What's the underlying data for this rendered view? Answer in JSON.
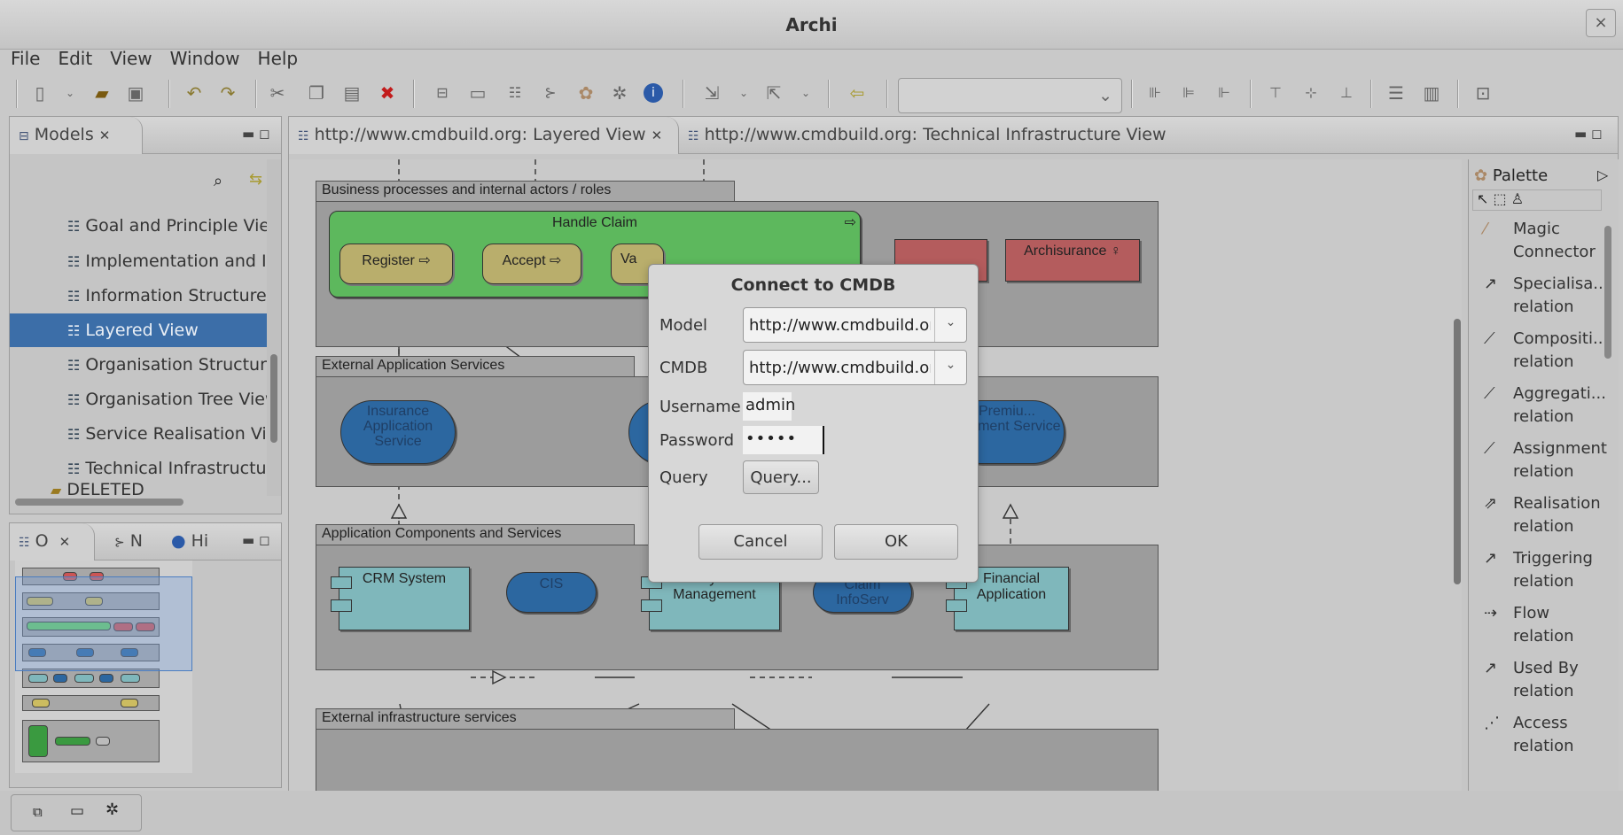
{
  "window": {
    "title": "Archi",
    "close": "×"
  },
  "menu": [
    "File",
    "Edit",
    "View",
    "Window",
    "Help"
  ],
  "toolbar": {
    "icons": [
      "new-icon",
      "open-icon",
      "save-icon",
      "undo-icon",
      "redo-icon",
      "cut-icon",
      "copy-icon",
      "paste-icon",
      "delete-icon",
      "models-tree-icon",
      "properties-icon",
      "outline-icon",
      "navigator-icon",
      "palette-icon",
      "viewpoint-icon",
      "info-icon",
      "import-icon",
      "export-icon",
      "back-icon"
    ],
    "combo_value": ""
  },
  "models": {
    "tab": "Models",
    "items": [
      {
        "label": "Goal and Principle View"
      },
      {
        "label": "Implementation and In"
      },
      {
        "label": "Information Structure"
      },
      {
        "label": "Layered View"
      },
      {
        "label": "Organisation Structure"
      },
      {
        "label": "Organisation Tree View"
      },
      {
        "label": "Service Realisation Vie"
      },
      {
        "label": "Technical Infrastructure"
      }
    ],
    "folder": "DELETED"
  },
  "bottom_tabs": {
    "outline": "O",
    "navigator": "N",
    "hints": "Hi"
  },
  "editor_tabs": {
    "active": "http://www.cmdbuild.org: Layered View",
    "other": "http://www.cmdbuild.org: Technical Infrastructure View"
  },
  "diagram": {
    "groups": {
      "business": "Business processes and internal actors / roles",
      "ext_app": "External Application Services",
      "app_comp": "Application Components and Services",
      "ext_infra": "External infrastructure services"
    },
    "process": "Handle Claim",
    "steps": [
      "Register",
      "Accept",
      "Va"
    ],
    "actor": "Archisurance",
    "services": [
      "Insurance Application Service",
      "Premiu... Payment Service"
    ],
    "components": [
      "CRM System",
      "Policy Data Management",
      "Financial Application"
    ],
    "app_services": [
      "CIS",
      "Claim InfoServ"
    ]
  },
  "palette": {
    "title": "Palette",
    "items": [
      {
        "l1": "Magic",
        "l2": "Connector"
      },
      {
        "l1": "Specialisa...",
        "l2": "relation"
      },
      {
        "l1": "Compositi...",
        "l2": "relation"
      },
      {
        "l1": "Aggregati...",
        "l2": "relation"
      },
      {
        "l1": "Assignment",
        "l2": "relation"
      },
      {
        "l1": "Realisation",
        "l2": "relation"
      },
      {
        "l1": "Triggering",
        "l2": "relation"
      },
      {
        "l1": "Flow",
        "l2": "relation"
      },
      {
        "l1": "Used By",
        "l2": "relation"
      },
      {
        "l1": "Access",
        "l2": "relation"
      }
    ]
  },
  "dialog": {
    "title": "Connect to CMDB",
    "model_label": "Model",
    "model_value": "http://www.cmdbuild.org: Layered View",
    "cmdb_label": "CMDB",
    "cmdb_value": "http://www.cmdbuild.org",
    "username_label": "Username",
    "username_value": "admin",
    "password_label": "Password",
    "password_value": "•••••",
    "query_label": "Query",
    "query_button": "Query...",
    "cancel": "Cancel",
    "ok": "OK"
  }
}
